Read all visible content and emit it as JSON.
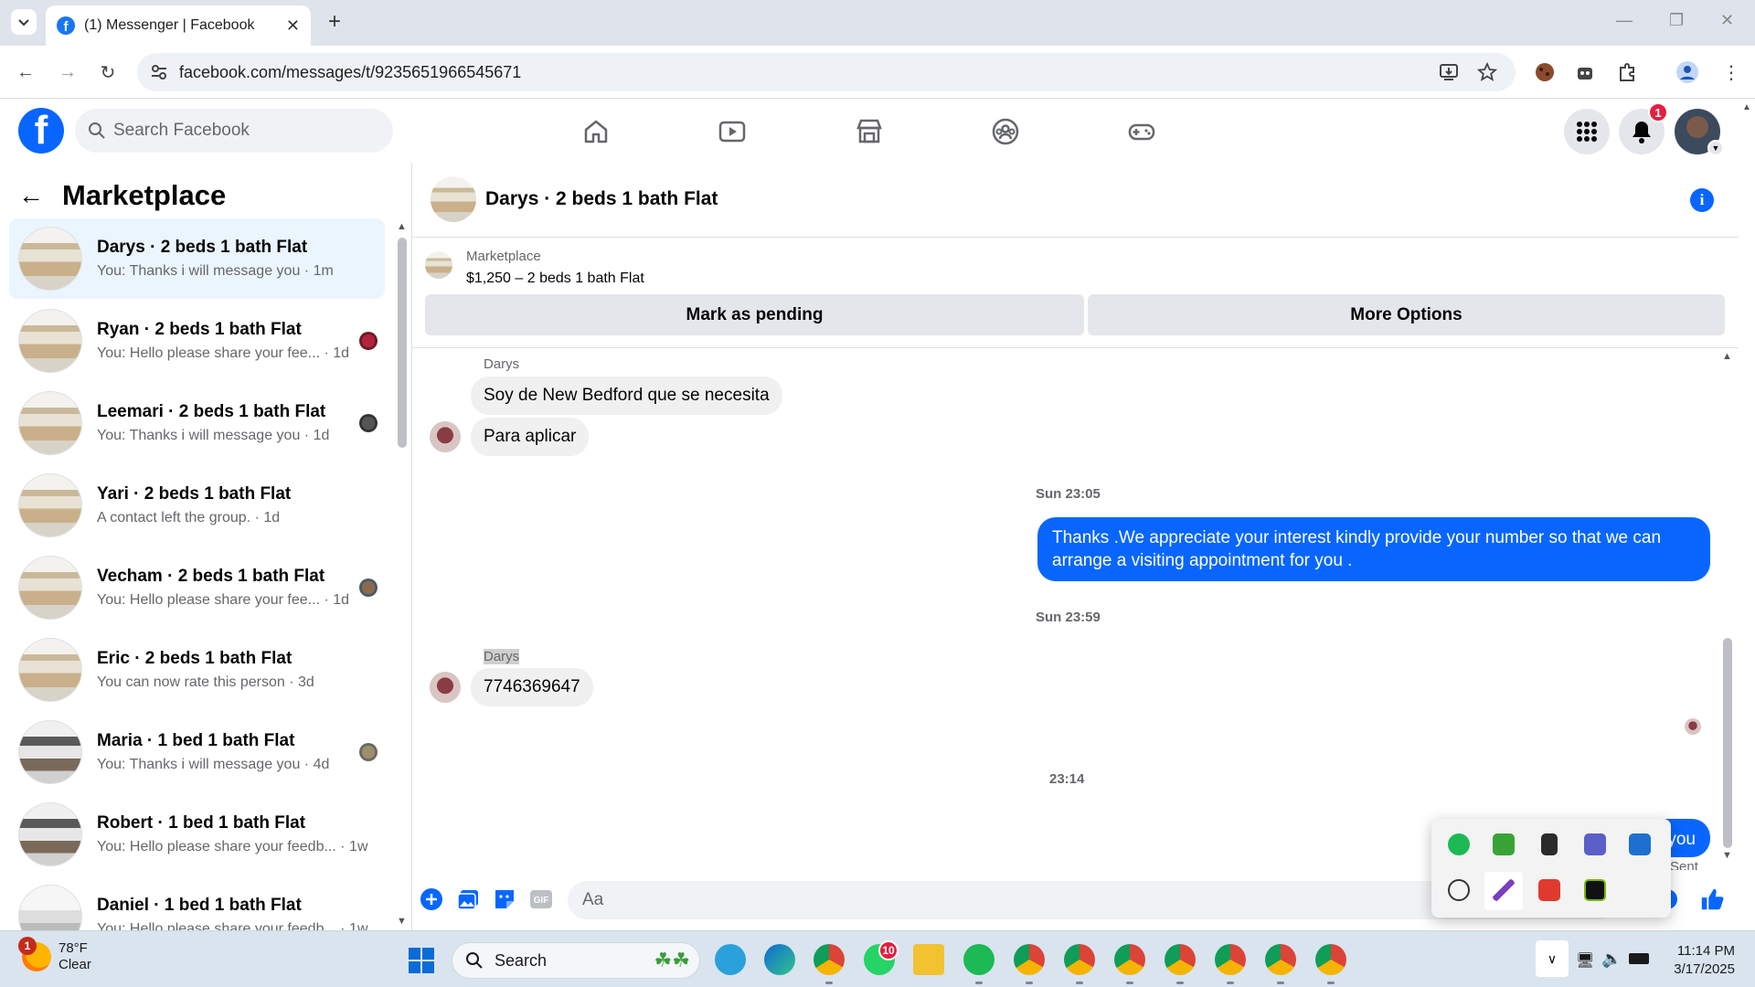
{
  "browser": {
    "tab_title": "(1) Messenger | Facebook",
    "url": "facebook.com/messages/t/9235651966545671"
  },
  "fb": {
    "search_placeholder": "Search Facebook",
    "notification_count": "1",
    "brand_color": "#0866ff"
  },
  "left": {
    "title": "Marketplace",
    "conversations": [
      {
        "name": "Darys · 2 beds 1 bath Flat",
        "snippet": "You: Thanks i will message you",
        "time": "· 1m",
        "active": true
      },
      {
        "name": "Ryan · 2 beds 1 bath Flat",
        "snippet": "You: Hello please share your fee...",
        "time": "· 1d"
      },
      {
        "name": "Leemari · 2 beds 1 bath Flat",
        "snippet": "You: Thanks i will message you",
        "time": "· 1d"
      },
      {
        "name": "Yari · 2 beds 1 bath Flat",
        "snippet": "A contact left the group.",
        "time": "· 1d"
      },
      {
        "name": "Vecham · 2 beds 1 bath Flat",
        "snippet": "You: Hello please share your fee...",
        "time": "· 1d"
      },
      {
        "name": "Eric · 2 beds 1 bath Flat",
        "snippet": "You can now rate this person",
        "time": "· 3d"
      },
      {
        "name": "Maria · 1 bed 1 bath Flat",
        "snippet": "You: Thanks i will message you",
        "time": "· 4d"
      },
      {
        "name": "Robert · 1 bed 1 bath Flat",
        "snippet": "You: Hello please share your feedb...",
        "time": "· 1w"
      },
      {
        "name": "Daniel · 1 bed 1 bath Flat",
        "snippet": "You: Hello please share your feedb...",
        "time": "· 1w"
      }
    ]
  },
  "chat": {
    "title": "Darys · 2 beds 1 bath Flat",
    "marketplace_label": "Marketplace",
    "listing": "$1,250 – 2 beds 1 bath Flat",
    "mark_pending": "Mark as pending",
    "more_options": "More Options",
    "messages": {
      "sender1": "Darys",
      "in1": "Soy de New Bedford que se necesita",
      "in2": "Para aplicar",
      "time1": "Sun 23:05",
      "out1": "Thanks .We appreciate your interest kindly provide your number so that we can arrange a visiting appointment for you .",
      "time2": "Sun 23:59",
      "sender2": "Darys",
      "in3": "7746369647",
      "time3": "23:14",
      "out2_partial": "you",
      "status": "Sent"
    },
    "composer_placeholder": "Aa"
  },
  "taskbar": {
    "temp": "78°F",
    "condition": "Clear",
    "weather_badge": "1",
    "search_label": "Search",
    "whatsapp_badge": "10",
    "time": "11:14 PM",
    "date": "3/17/2025"
  }
}
